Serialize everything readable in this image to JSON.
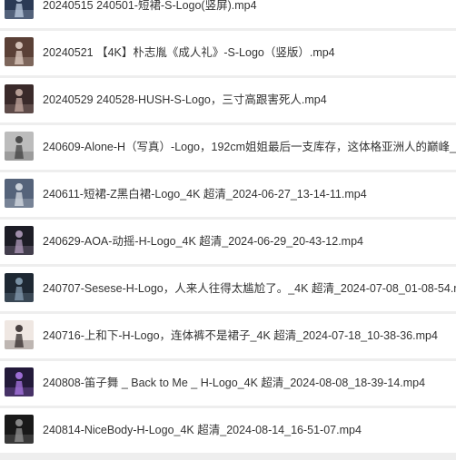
{
  "files": [
    {
      "name": "20240515 240501-短裙-S-Logo(竖屏).mp4",
      "thumb": {
        "bg": "#2b3a55",
        "fg": "#c8d6ea"
      }
    },
    {
      "name": "20240521 【4K】朴志胤《成人礼》-S-Logo（竖版）.mp4",
      "thumb": {
        "bg": "#5a4036",
        "fg": "#e9d7cc"
      }
    },
    {
      "name": "20240529 240528-HUSH-S-Logo，三寸高跟害死人.mp4",
      "thumb": {
        "bg": "#3a2a2a",
        "fg": "#cdb1a8"
      }
    },
    {
      "name": "240609-Alone-H（写真）-Logo，192cm姐姐最后一支库存，这体格亚洲人的巅峰_4",
      "thumb": {
        "bg": "#bcbcbc",
        "fg": "#3a3a3a"
      }
    },
    {
      "name": "240611-短裙-Z黑白裙-Logo_4K 超清_2024-06-27_13-14-11.mp4",
      "thumb": {
        "bg": "#55637a",
        "fg": "#e0e4ea"
      }
    },
    {
      "name": "240629-AOA-动摇-H-Logo_4K 超清_2024-06-29_20-43-12.mp4",
      "thumb": {
        "bg": "#1d1d26",
        "fg": "#b9a3c4"
      }
    },
    {
      "name": "240707-Sesese-H-Logo，人来人往得太尴尬了。_4K 超清_2024-07-08_01-08-54.m",
      "thumb": {
        "bg": "#1e2833",
        "fg": "#8aa3b8"
      }
    },
    {
      "name": "240716-上和下-H-Logo，连体裤不是裙子_4K 超清_2024-07-18_10-38-36.mp4",
      "thumb": {
        "bg": "#efe7e2",
        "fg": "#2a2222"
      }
    },
    {
      "name": "240808-笛子舞 _ Back to Me _ H-Logo_4K 超清_2024-08-08_18-39-14.mp4",
      "thumb": {
        "bg": "#231a3a",
        "fg": "#b27cf0"
      }
    },
    {
      "name": "240814-NiceBody-H-Logo_4K 超清_2024-08-14_16-51-07.mp4",
      "thumb": {
        "bg": "#191919",
        "fg": "#9a9a9a"
      }
    }
  ]
}
